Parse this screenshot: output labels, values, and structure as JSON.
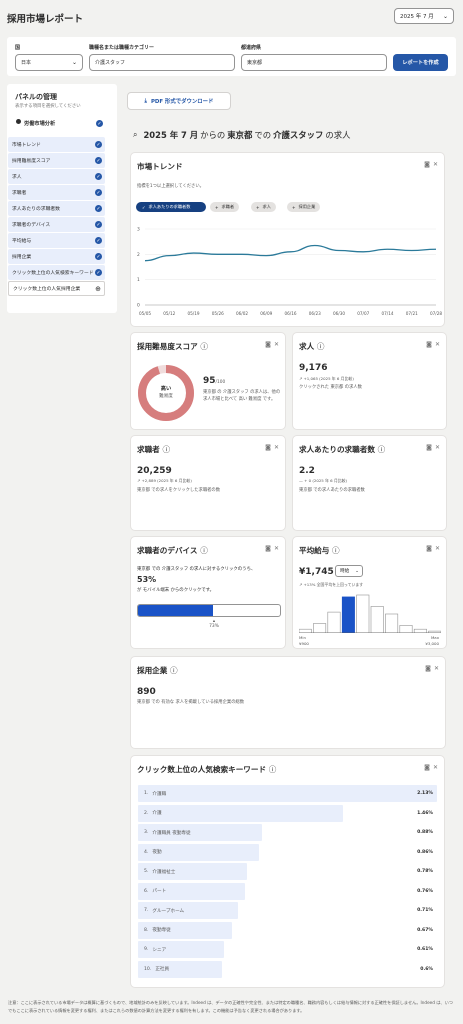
{
  "header": {
    "title": "採用市場レポート",
    "month_select": "2025 年 7 月"
  },
  "filters": {
    "country_label": "国",
    "country_value": "日本",
    "job_label": "職種名または職種カテゴリー",
    "job_value": "介護スタッフ",
    "pref_label": "都道府県",
    "pref_value": "東京都",
    "create_button": "レポートを作成"
  },
  "panel": {
    "title": "パネルの管理",
    "subtitle": "表示する項目を選択してください",
    "section": "労働市場分析",
    "items": [
      {
        "label": "市場トレンド",
        "checked": true
      },
      {
        "label": "採用難易度スコア",
        "checked": true
      },
      {
        "label": "求人",
        "checked": true
      },
      {
        "label": "求職者",
        "checked": true
      },
      {
        "label": "求人あたりの求職者数",
        "checked": true
      },
      {
        "label": "求職者のデバイス",
        "checked": true
      },
      {
        "label": "平均給与",
        "checked": true
      },
      {
        "label": "採用企業",
        "checked": true
      },
      {
        "label": "クリック数上位の人気検索キーワード",
        "checked": true
      },
      {
        "label": "クリック数上位の人気採用企業",
        "checked": false
      }
    ]
  },
  "pdf_button": "PDF 形式でダウンロード",
  "report_heading": {
    "p1": "2025 年 7 月",
    "p2": "からの",
    "p3": "東京都",
    "p4": "での",
    "p5": "介護スタッフ",
    "p6": "の求人"
  },
  "trend": {
    "title": "市場トレンド",
    "hint": "指標を1つ以上選択してください。",
    "pills": [
      "求人あたりの求職者数",
      "求職者",
      "求人",
      "採用企業"
    ],
    "chart_data": {
      "type": "line",
      "x": [
        "05/05",
        "05/12",
        "05/19",
        "05/26",
        "06/02",
        "06/09",
        "06/16",
        "06/23",
        "06/30",
        "07/07",
        "07/14",
        "07/21",
        "07/28"
      ],
      "series": [
        {
          "values": [
            1.75,
            1.95,
            2.05,
            2.0,
            2.0,
            1.95,
            2.1,
            2.35,
            2.15,
            2.1,
            2.2,
            2.15,
            2.2
          ]
        }
      ],
      "yticks": [
        "0",
        "1",
        "2",
        "3"
      ],
      "ylim": [
        0,
        3
      ]
    }
  },
  "difficulty": {
    "title": "採用難易度スコア",
    "ring_top": "高い",
    "ring_bottom": "難易度",
    "score": "95",
    "score_max": "/100",
    "desc": "東京都 の 介護スタッフ の求人は、他の求人市場と比べて 高い 難易度 です。",
    "score_frac": 0.95
  },
  "jobs": {
    "title": "求人",
    "value": "9,176",
    "change": "+1,065 (2025 年 6 月比較)",
    "desc": "クリックされた 東京都 の求人数"
  },
  "seekers": {
    "title": "求職者",
    "value": "20,259",
    "change": "+2,889 (2025 年 6 月比較)",
    "desc": "東京都 での求人をクリックした求職者の数"
  },
  "per_job": {
    "title": "求人あたりの求職者数",
    "value": "2.2",
    "change": "+ 0 (2025 年 6 月比較)",
    "desc": "東京都 での求人あたりの求職者数"
  },
  "devices": {
    "title": "求職者のデバイス",
    "line1": "東京都 での 介護スタッフ の求人に対するクリックのうち、",
    "pct": "53%",
    "line2": "が モバイル端末 からのクリックです。",
    "bar_label": "73%",
    "frac": 0.53
  },
  "salary": {
    "title": "平均給与",
    "value": "¥1,745",
    "unit": "時給",
    "change": "+13% 全国平均を上回っています",
    "min_label": "Min",
    "max_label": "Max",
    "min": "¥900",
    "max": "¥3,000",
    "bars": [
      0.1,
      0.25,
      0.55,
      0.95,
      1.0,
      0.7,
      0.5,
      0.2,
      0.1,
      0.05
    ]
  },
  "employers": {
    "title": "採用企業",
    "value": "890",
    "desc": "東京都 での 有効な 求人を掲載している採用企業の総数"
  },
  "keywords": {
    "title": "クリック数上位の人気検索キーワード",
    "rows": [
      {
        "rank": "1.",
        "kw": "介護職",
        "pct": "2.13%",
        "v": 2.13
      },
      {
        "rank": "2.",
        "kw": "介護",
        "pct": "1.46%",
        "v": 1.46
      },
      {
        "rank": "3.",
        "kw": "介護職員 夜勤専従",
        "pct": "0.88%",
        "v": 0.88
      },
      {
        "rank": "4.",
        "kw": "夜勤",
        "pct": "0.86%",
        "v": 0.86
      },
      {
        "rank": "5.",
        "kw": "介護福祉士",
        "pct": "0.78%",
        "v": 0.78
      },
      {
        "rank": "6.",
        "kw": "パート",
        "pct": "0.76%",
        "v": 0.76
      },
      {
        "rank": "7.",
        "kw": "グループホーム",
        "pct": "0.71%",
        "v": 0.71
      },
      {
        "rank": "8.",
        "kw": "夜勤専従",
        "pct": "0.67%",
        "v": 0.67
      },
      {
        "rank": "9.",
        "kw": "シニア",
        "pct": "0.61%",
        "v": 0.61
      },
      {
        "rank": "10.",
        "kw": "正社員",
        "pct": "0.6%",
        "v": 0.6
      }
    ]
  },
  "footer": "注意：ここに表示されている市場データは概算に基づくもので、地域統計のみを反映しています。Indeed は、データの正確性や完全性、または特定の職種名、職務内容もしくは給与情報に対する正確性を保証しません。Indeed は、いつでもここに表示されている情報を変更する権利、またはこれらの数値の計算方法を変更する権利を有します。この機能は予告なく変更される場合があります。"
}
